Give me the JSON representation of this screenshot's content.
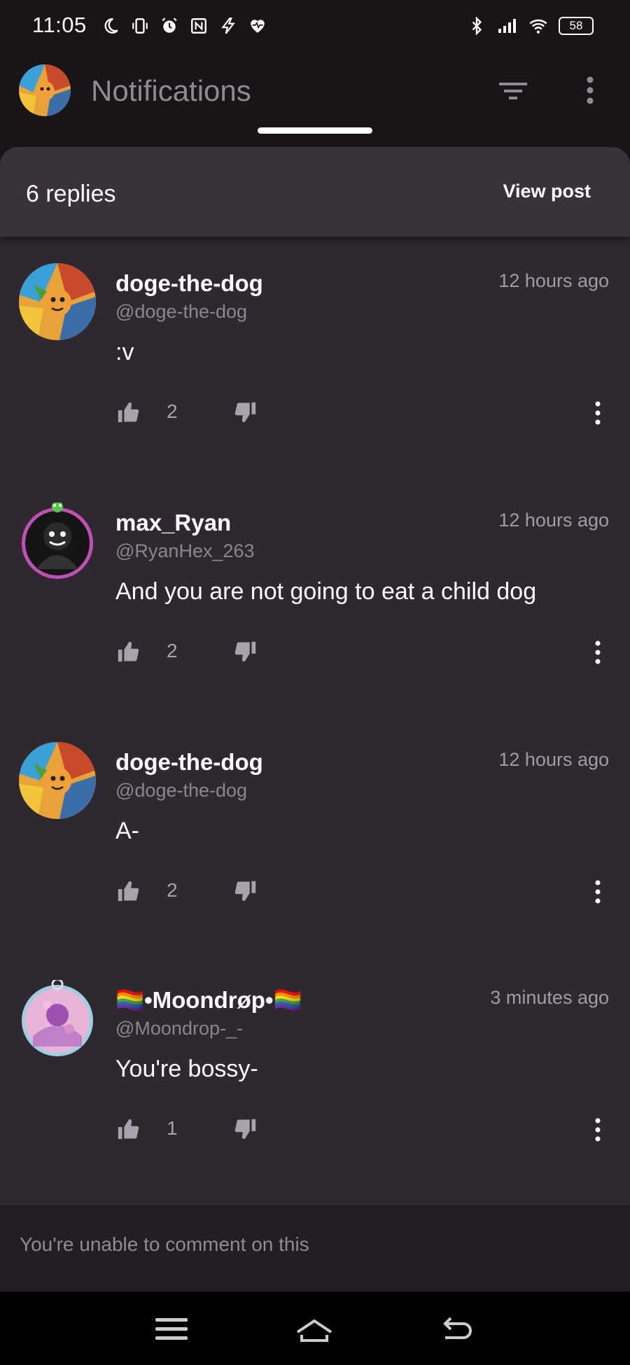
{
  "status_bar": {
    "time": "11:05",
    "battery": "58",
    "left_icons": [
      "moon-icon",
      "vibrate-icon",
      "alarm-icon",
      "nfc-icon",
      "flash-icon",
      "heart-monitor-icon"
    ],
    "right_icons": [
      "bluetooth-icon",
      "signal-icon",
      "wifi-icon",
      "battery-icon"
    ]
  },
  "app_bar": {
    "title": "Notifications"
  },
  "sheet": {
    "replies_count": "6 replies",
    "view_post_label": "View post"
  },
  "comments": [
    {
      "name": "doge-the-dog",
      "handle": "@doge-the-dog",
      "time": "12 hours ago",
      "text": ":v",
      "likes": "2"
    },
    {
      "name": "max_Ryan",
      "handle": "@RyanHex_263",
      "time": "12 hours ago",
      "text": "And you are not going to eat a child dog",
      "likes": "2"
    },
    {
      "name": "doge-the-dog",
      "handle": "@doge-the-dog",
      "time": "12 hours ago",
      "text": "A-",
      "likes": "2"
    },
    {
      "name": "🏳️‍🌈•Moondrøp•🏳️‍🌈",
      "handle": "@Moondrop-_-",
      "time": "3 minutes ago",
      "text": "You're bossy-",
      "likes": "1"
    }
  ],
  "footer": {
    "text": "You're unable to comment on this"
  },
  "nav_bar": {
    "icons": [
      "menu-lines-icon",
      "home-icon",
      "back-icon"
    ]
  },
  "colors": {
    "background": "#181418",
    "sheet": "#302830",
    "sheet_header": "#3a323a",
    "muted_text": "#8c8590"
  }
}
